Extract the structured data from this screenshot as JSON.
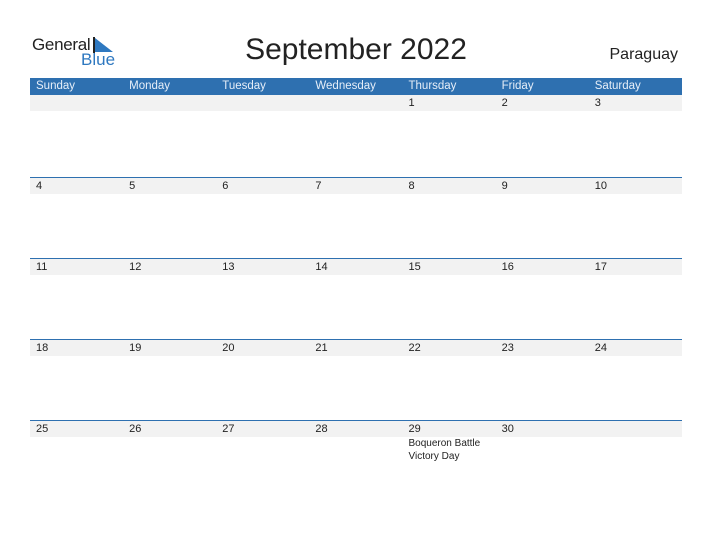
{
  "logo": {
    "line1": "General",
    "line2": "Blue"
  },
  "title": "September 2022",
  "country": "Paraguay",
  "days": [
    "Sunday",
    "Monday",
    "Tuesday",
    "Wednesday",
    "Thursday",
    "Friday",
    "Saturday"
  ],
  "weeks": [
    {
      "dates": [
        "",
        "",
        "",
        "",
        "1",
        "2",
        "3"
      ],
      "notes": [
        "",
        "",
        "",
        "",
        "",
        "",
        ""
      ]
    },
    {
      "dates": [
        "4",
        "5",
        "6",
        "7",
        "8",
        "9",
        "10"
      ],
      "notes": [
        "",
        "",
        "",
        "",
        "",
        "",
        ""
      ]
    },
    {
      "dates": [
        "11",
        "12",
        "13",
        "14",
        "15",
        "16",
        "17"
      ],
      "notes": [
        "",
        "",
        "",
        "",
        "",
        "",
        ""
      ]
    },
    {
      "dates": [
        "18",
        "19",
        "20",
        "21",
        "22",
        "23",
        "24"
      ],
      "notes": [
        "",
        "",
        "",
        "",
        "",
        "",
        ""
      ]
    },
    {
      "dates": [
        "25",
        "26",
        "27",
        "28",
        "29",
        "30",
        ""
      ],
      "notes": [
        "",
        "",
        "",
        "",
        "Boqueron Battle Victory Day",
        "",
        ""
      ]
    }
  ],
  "colors": {
    "accent": "#2e70b0",
    "strip": "#f2f2f2"
  }
}
